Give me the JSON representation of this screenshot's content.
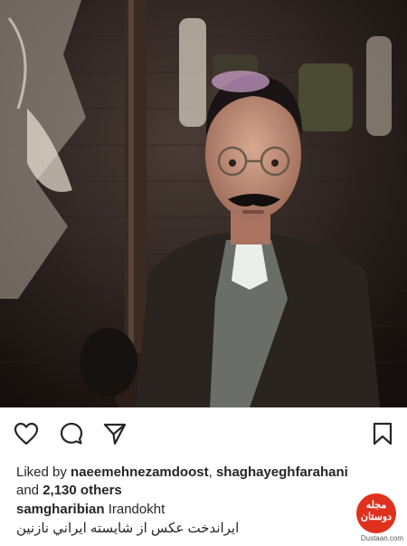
{
  "post": {
    "photo_alt": "Actor in period costume with round glasses and rifle",
    "liked_prefix": "Liked by ",
    "liked_user1": "naeemehnezamdoost",
    "liked_sep": ", ",
    "liked_user2": "shaghayeghfarahani",
    "liked_and": "and ",
    "liked_others": "2,130 others",
    "author": "samgharibian",
    "caption_en": "Irandokht",
    "caption_fa": "ايراندخت عکس از شايسته ايراني نازنين"
  },
  "actions": {
    "like_icon": "heart-icon",
    "comment_icon": "comment-icon",
    "share_icon": "share-icon",
    "save_icon": "bookmark-icon"
  },
  "watermark": {
    "brand": "مجله دوستان",
    "url": "Dustaan.com",
    "color": "#e0311f"
  }
}
